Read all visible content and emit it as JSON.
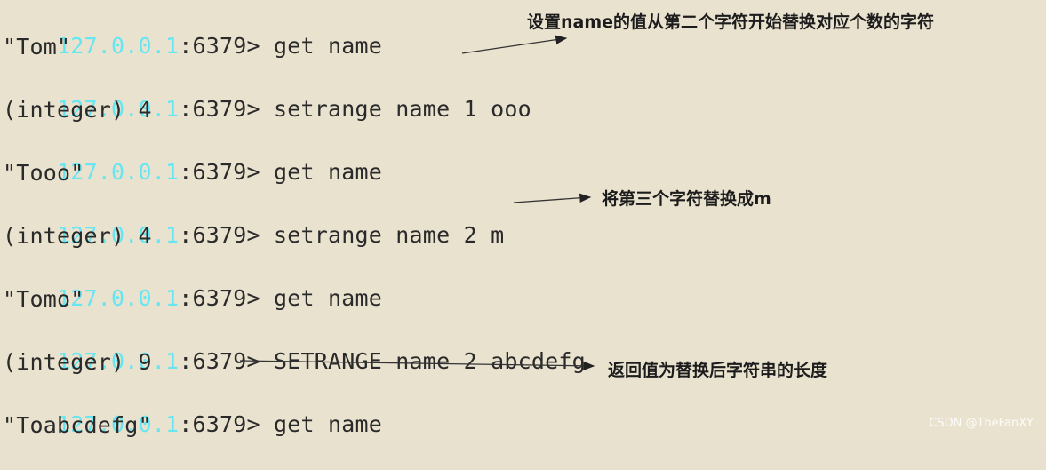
{
  "terminal": {
    "ip_color": "#66e6f2",
    "text_color": "#2a2a2a",
    "background": "#e9e2cf",
    "lines": [
      {
        "ip": "127.0.0.1",
        "port": ":6379>",
        "cmd": " get name"
      },
      {
        "out": "\"Tom\""
      },
      {
        "ip": "127.0.0.1",
        "port": ":6379>",
        "cmd": " setrange name 1 ooo"
      },
      {
        "out": "(integer) 4"
      },
      {
        "ip": "127.0.0.1",
        "port": ":6379>",
        "cmd": " get name"
      },
      {
        "out": "\"Tooo\""
      },
      {
        "ip": "127.0.0.1",
        "port": ":6379>",
        "cmd": " setrange name 2 m"
      },
      {
        "out": "(integer) 4"
      },
      {
        "ip": "127.0.0.1",
        "port": ":6379>",
        "cmd": " get name"
      },
      {
        "out": "\"Tomo\""
      },
      {
        "ip": "127.0.0.1",
        "port": ":6379>",
        "cmd": " SETRANGE name 2 abcdefg"
      },
      {
        "out": "(integer) 9"
      },
      {
        "ip": "127.0.0.1",
        "port": ":6379>",
        "cmd": " get name"
      },
      {
        "out": "\"Toabcdefg\""
      }
    ]
  },
  "annotations": {
    "note1": "设置name的值从第二个字符开始替换对应个数的字符",
    "note2": "将第三个字符替换成m",
    "note3": "返回值为替换后字符串的长度"
  },
  "watermark": "CSDN @TheFanXY"
}
